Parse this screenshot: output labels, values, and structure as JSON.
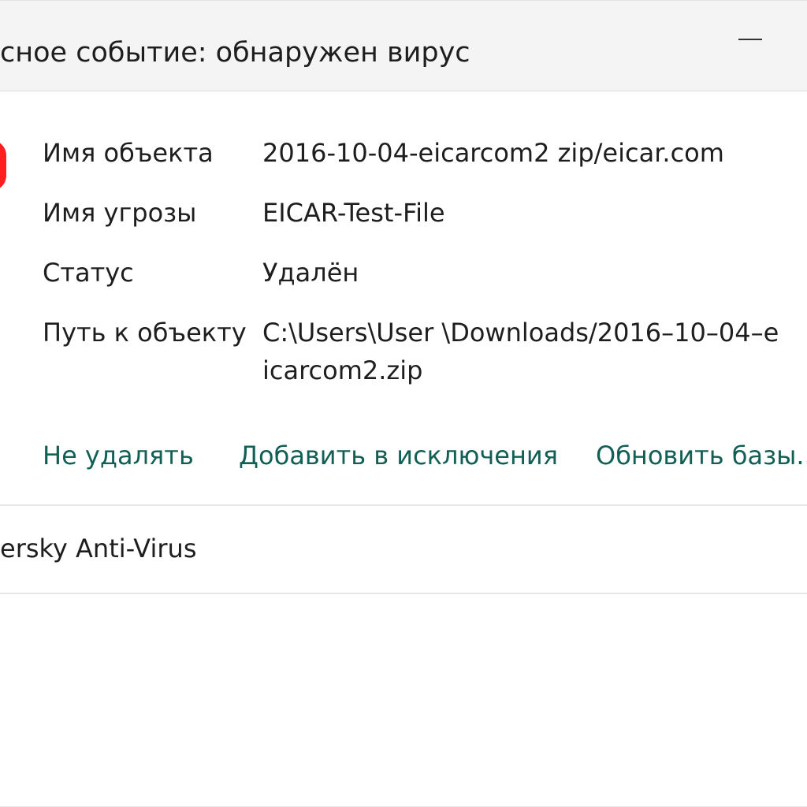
{
  "window": {
    "title": "сное событие: обнаружен вирус"
  },
  "details": {
    "rows": [
      {
        "label": "Имя объекта",
        "value": "2016-10-04-eicarcom2 zip/eicar.com"
      },
      {
        "label": "Имя угрозы",
        "value": "EICAR-Test-File"
      },
      {
        "label": "Статус",
        "value": "Удалён"
      },
      {
        "label": "Путь к объекту",
        "value": "C:\\Users\\User \\Downloads/2016–10–04–eicarcom2.zip"
      }
    ]
  },
  "actions": {
    "dont_delete": "Не удалять",
    "add_exclusion": "Добавить в исключения",
    "update_bases": "Обновить базы..."
  },
  "footer": {
    "product": "ersky Anti-Virus"
  },
  "colors": {
    "link": "#125f55",
    "status_dot": "#ff1f1f",
    "title_bar_bg": "#f4f4f4"
  },
  "icons": {
    "minimize": "minimize-icon",
    "status": "alert-dot-icon"
  }
}
